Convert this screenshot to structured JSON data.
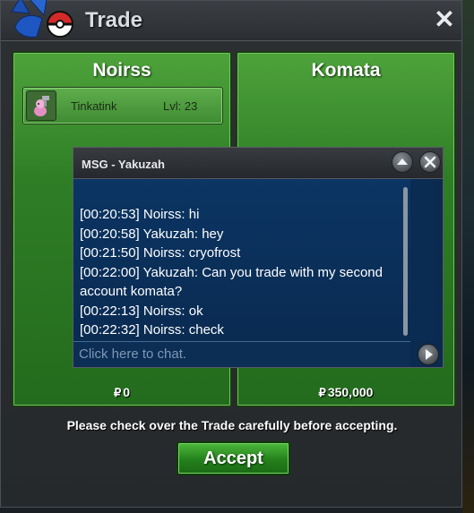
{
  "window": {
    "title": "Trade",
    "close_label": "✕"
  },
  "left_panel": {
    "name": "Noirss",
    "pokemon": {
      "name": "Tinkatink",
      "level": "Lvl: 23"
    },
    "money_symbol": "₽",
    "money": "0"
  },
  "right_panel": {
    "name": "Komata",
    "money_symbol": "₽",
    "money": "350,000"
  },
  "chat": {
    "title": "MSG - Yakuzah",
    "messages": [
      "[00:20:53] Noirss: hi",
      "[00:20:58] Yakuzah: hey",
      "[00:21:50] Noirss: cryofrost",
      "[00:22:00] Yakuzah: Can you trade with my second account komata?",
      "[00:22:13] Noirss: ok",
      "[00:22:32] Noirss: check"
    ],
    "input_placeholder": "Click here to chat."
  },
  "notice": "Please check over the Trade carefully before accepting.",
  "accept_label": "Accept",
  "colors": {
    "panel_green": "#2f7e26",
    "chat_blue": "#0a2b52",
    "accept_green": "#24801c"
  }
}
